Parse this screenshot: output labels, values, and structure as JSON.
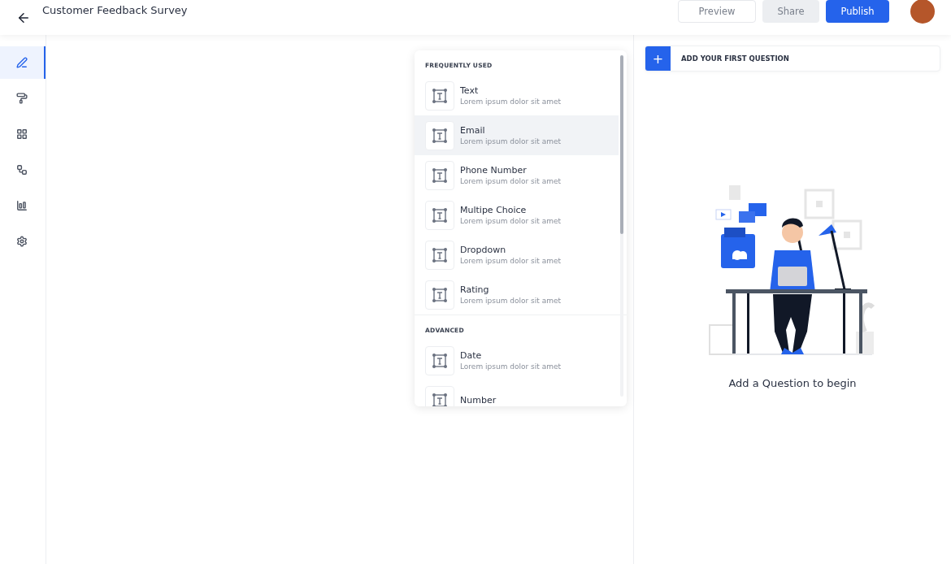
{
  "header": {
    "title": "Customer Feedback Survey",
    "buttons": [
      {
        "label": "Preview",
        "kind": "outline"
      },
      {
        "label": "Share",
        "kind": "muted"
      },
      {
        "label": "Publish",
        "kind": "primary"
      }
    ]
  },
  "sidebar": {
    "items": [
      {
        "selected": true
      },
      {
        "selected": false
      },
      {
        "selected": false
      },
      {
        "selected": false
      },
      {
        "selected": false
      },
      {
        "selected": false
      }
    ]
  },
  "question_menu": {
    "sections": [
      {
        "title": "FREQUENTLY USED",
        "items": [
          {
            "label": "Text",
            "description": "Lorem ipsum dolor sit amet",
            "highlighted": false
          },
          {
            "label": "Email",
            "description": "Lorem ipsum dolor sit amet",
            "highlighted": true
          },
          {
            "label": "Phone Number",
            "description": "Lorem ipsum dolor sit amet",
            "highlighted": false
          },
          {
            "label": "Multipe Choice",
            "description": "Lorem ipsum dolor sit amet",
            "highlighted": false
          },
          {
            "label": "Dropdown",
            "description": "Lorem ipsum dolor sit amet",
            "highlighted": false
          },
          {
            "label": "Rating",
            "description": "Lorem ipsum dolor sit amet",
            "highlighted": false
          }
        ]
      },
      {
        "title": "ADVANCED",
        "items": [
          {
            "label": "Date",
            "description": "Lorem ipsum dolor sit amet",
            "highlighted": false
          },
          {
            "label": "Number",
            "highlighted": false
          }
        ]
      }
    ]
  },
  "questions_panel": {
    "add_button": {
      "icon": "+",
      "label": "ADD YOUR FIRST QUESTION"
    },
    "empty_message": "Add a Question to begin"
  }
}
